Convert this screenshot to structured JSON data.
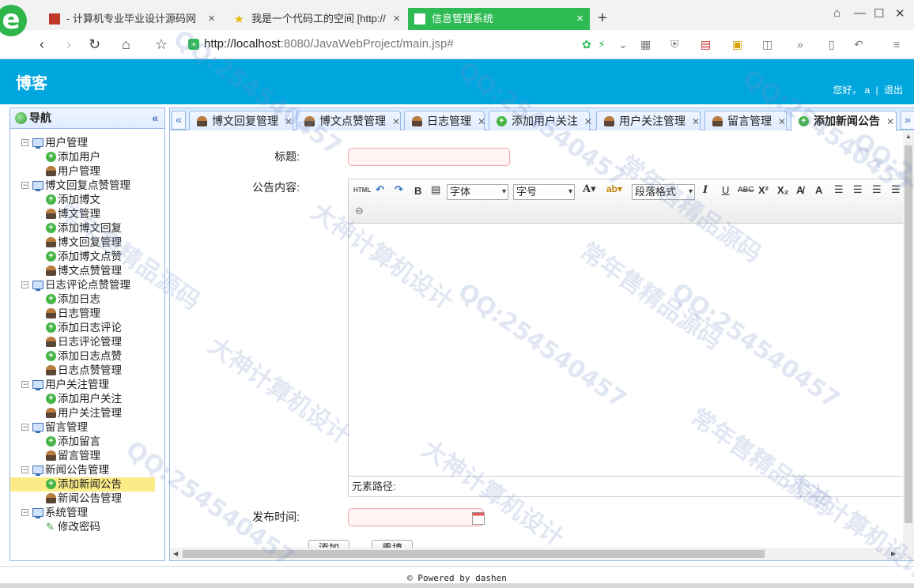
{
  "browser": {
    "tabs": [
      {
        "title": "- 计算机专业毕业设计源码网",
        "active": false
      },
      {
        "title": "我是一个代码工的空间 [http://",
        "active": false
      },
      {
        "title": "信息管理系统",
        "active": true
      }
    ],
    "url_host": "http://localhost",
    "url_rest": ":8080/JavaWebProject/main.jsp#"
  },
  "header": {
    "title": "博客",
    "greeting": "您好，",
    "username": "a",
    "separator": "|",
    "logout": "退出"
  },
  "sidebar": {
    "title": "导航",
    "groups": [
      {
        "label": "用户管理",
        "items": [
          {
            "label": "添加用户",
            "icon": "add-icon"
          },
          {
            "label": "用户管理",
            "icon": "user-icon"
          }
        ]
      },
      {
        "label": "博文回复点赞管理",
        "items": [
          {
            "label": "添加博文",
            "icon": "add-icon"
          },
          {
            "label": "博文管理",
            "icon": "user-icon"
          },
          {
            "label": "添加博文回复",
            "icon": "add-icon"
          },
          {
            "label": "博文回复管理",
            "icon": "user-icon"
          },
          {
            "label": "添加博文点赞",
            "icon": "add-icon"
          },
          {
            "label": "博文点赞管理",
            "icon": "user-icon"
          }
        ]
      },
      {
        "label": "日志评论点赞管理",
        "items": [
          {
            "label": "添加日志",
            "icon": "add-icon"
          },
          {
            "label": "日志管理",
            "icon": "user-icon"
          },
          {
            "label": "添加日志评论",
            "icon": "add-icon"
          },
          {
            "label": "日志评论管理",
            "icon": "user-icon"
          },
          {
            "label": "添加日志点赞",
            "icon": "add-icon"
          },
          {
            "label": "日志点赞管理",
            "icon": "user-icon"
          }
        ]
      },
      {
        "label": "用户关注管理",
        "items": [
          {
            "label": "添加用户关注",
            "icon": "add-icon"
          },
          {
            "label": "用户关注管理",
            "icon": "user-icon"
          }
        ]
      },
      {
        "label": "留言管理",
        "items": [
          {
            "label": "添加留言",
            "icon": "add-icon"
          },
          {
            "label": "留言管理",
            "icon": "user-icon"
          }
        ]
      },
      {
        "label": "新闻公告管理",
        "items": [
          {
            "label": "添加新闻公告",
            "icon": "add-icon",
            "selected": true
          },
          {
            "label": "新闻公告管理",
            "icon": "user-icon"
          }
        ]
      },
      {
        "label": "系统管理",
        "items": [
          {
            "label": "修改密码",
            "icon": "pencil-icon"
          }
        ]
      }
    ]
  },
  "page_tabs": [
    {
      "label": "博文回复管理",
      "icon": "user-icon"
    },
    {
      "label": "博文点赞管理",
      "icon": "user-icon"
    },
    {
      "label": "日志管理",
      "icon": "user-icon"
    },
    {
      "label": "添加用户关注",
      "icon": "add-icon"
    },
    {
      "label": "用户关注管理",
      "icon": "user-icon"
    },
    {
      "label": "留言管理",
      "icon": "user-icon"
    },
    {
      "label": "添加新闻公告",
      "icon": "add-icon",
      "active": true
    }
  ],
  "form": {
    "title_label": "标题:",
    "content_label": "公告内容:",
    "publish_time_label": "发布时间:",
    "title_value": "",
    "publish_time_value": "",
    "submit_label": "添加",
    "reset_label": "重填"
  },
  "editor": {
    "html_label": "HTML",
    "font_select": "字体",
    "size_select": "字号",
    "format_select": "段落格式",
    "element_path": "元素路径:"
  },
  "footer": {
    "text": "© Powered by dashen"
  },
  "watermark": {
    "lines": [
      "QQ:254540457",
      "大神计算机设计",
      "常年售精品源码"
    ]
  }
}
